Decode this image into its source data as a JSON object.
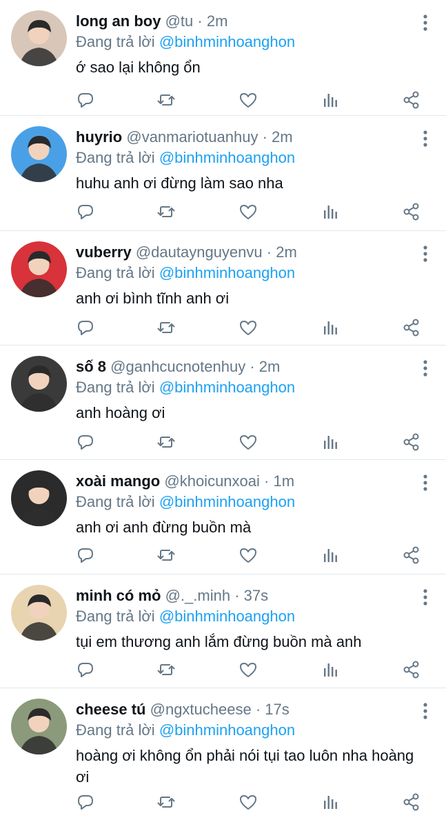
{
  "tweets": [
    {
      "name": "long an boy",
      "handle": "@tu",
      "dot": "·",
      "time": "2m",
      "replying": "Đang trả lời",
      "mention": "@binhminhoanghon",
      "text": "ớ sao lại không ổn",
      "avatar_color": "#d8c7b8"
    },
    {
      "name": "huyrio",
      "handle": "@vanmariotuanhuy",
      "dot": "·",
      "time": "2m",
      "replying": "Đang trả lời",
      "mention": "@binhminhoanghon",
      "text": "huhu anh ơi đừng làm sao nha",
      "avatar_color": "#4aa0e6"
    },
    {
      "name": "vuberry",
      "handle": "@dautaynguyenvu",
      "dot": "·",
      "time": "2m",
      "replying": "Đang trả lời",
      "mention": "@binhminhoanghon",
      "text": "anh ơi bình tĩnh anh ơi",
      "avatar_color": "#d8323a"
    },
    {
      "name": "số 8",
      "handle": "@ganhcucnotenhuy",
      "dot": "·",
      "time": "2m",
      "replying": "Đang trả lời",
      "mention": "@binhminhoanghon",
      "text": "anh hoàng ơi",
      "avatar_color": "#3a3a3a"
    },
    {
      "name": "xoài mango",
      "handle": "@khoicunxoai",
      "dot": "·",
      "time": "1m",
      "replying": "Đang trả lời",
      "mention": "@binhminhoanghon",
      "text": "anh ơi anh đừng buồn mà",
      "avatar_color": "#2b2b2b"
    },
    {
      "name": "minh có mỏ",
      "handle": "@._.minh",
      "dot": "·",
      "time": "37s",
      "replying": "Đang trả lời",
      "mention": "@binhminhoanghon",
      "text": "tụi em thương anh lắm đừng buồn mà anh",
      "avatar_color": "#e8d4b0"
    },
    {
      "name": "cheese tú",
      "handle": "@ngxtucheese",
      "dot": "·",
      "time": "17s",
      "replying": "Đang trả lời",
      "mention": "@binhminhoanghon",
      "text": "hoàng ơi không ổn phải nói tụi tao luôn nha hoàng ơi",
      "avatar_color": "#8a9a7a"
    }
  ],
  "icons": [
    "reply-icon",
    "retweet-icon",
    "like-icon",
    "stats-icon",
    "share-icon",
    "more-icon"
  ],
  "colors": {
    "name": "#0f1419",
    "muted": "#657786",
    "link": "#1da1f2",
    "icon": "#657786",
    "divider": "#e1e8ed"
  }
}
